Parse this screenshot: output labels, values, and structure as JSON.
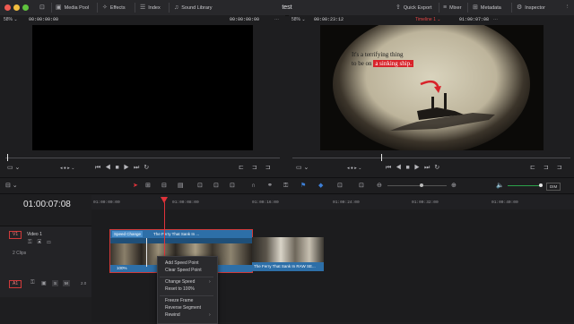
{
  "title": "test",
  "toolbar": {
    "media_pool": "Media Pool",
    "effects": "Effects",
    "index": "Index",
    "sound_library": "Sound Library",
    "quick_export": "Quick Export",
    "mixer": "Mixer",
    "metadata": "Metadata",
    "inspector": "Inspector"
  },
  "source_viewer": {
    "zoom": "58%",
    "timecode": "00:00:00:00",
    "duration": "00:00:00:00"
  },
  "timeline_viewer": {
    "zoom": "58%",
    "duration": "00:00:23:12",
    "timeline_name": "Timeline 1",
    "timecode": "01:00:07:08"
  },
  "frame_text": {
    "line1": "It's a terrifying thing",
    "line2_prefix": "to be on",
    "line2_highlight": "a sinking ship."
  },
  "timeline": {
    "timecode": "01:00:07:08",
    "ruler": [
      "01:00:00:00",
      "01:00:08:00",
      "01:00:16:00",
      "01:00:24:00",
      "01:00:32:00",
      "01:00:40:00"
    ],
    "video_track": {
      "id": "V1",
      "name": "Video 1",
      "clips_count": "2 Clips"
    },
    "audio_track": {
      "id": "A1",
      "level": "2.0",
      "solo": "S",
      "mute": "M"
    },
    "clip1": {
      "badge": "Speed Change",
      "name": "The Ferry That Sank In ...",
      "speed": "100%"
    },
    "clip2": {
      "name": "The Ferry That Sank In RAW SE..."
    },
    "dim_label": "DIM"
  },
  "context_menu": {
    "items": [
      "Add Speed Point",
      "Clear Speed Point",
      "Change Speed",
      "Reset to 100%",
      "Freeze Frame",
      "Reverse Segment",
      "Rewind"
    ]
  },
  "colors": {
    "playhead": "#e0333a",
    "clip_blue": "#2d6fa8",
    "track_red": "#d03a3a",
    "highlight": "#d8232a"
  }
}
